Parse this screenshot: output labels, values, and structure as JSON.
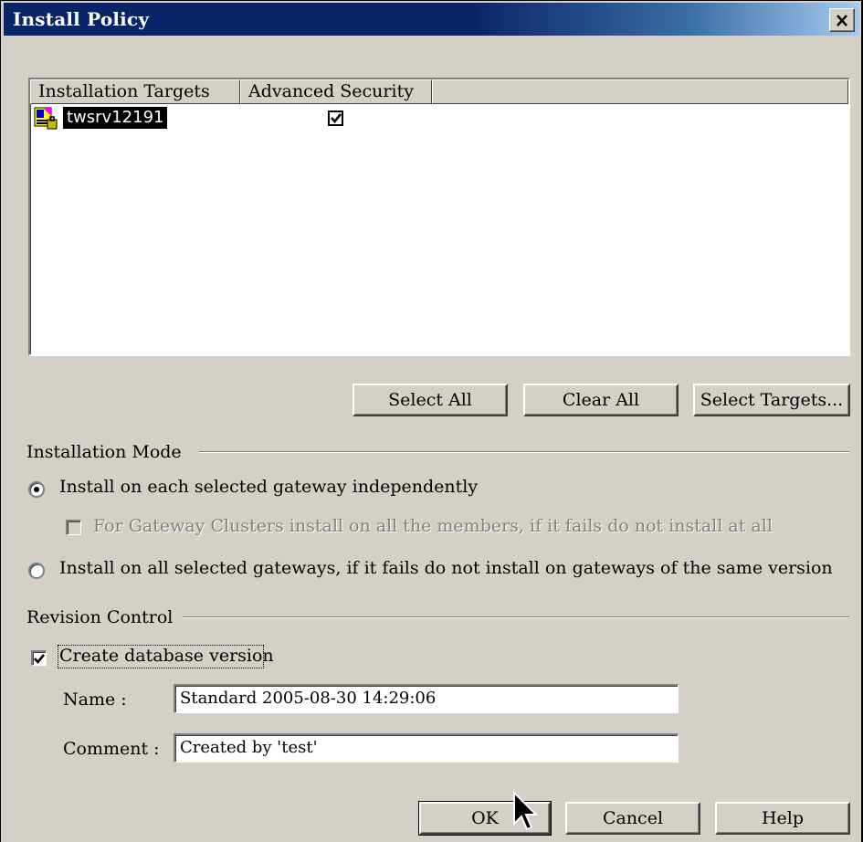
{
  "window": {
    "title": "Install Policy"
  },
  "targets": {
    "columns": [
      "Installation Targets",
      "Advanced Security"
    ],
    "rows": [
      {
        "name": "twsrv12191",
        "advanced_security": true
      }
    ]
  },
  "target_buttons": {
    "select_all": "Select All",
    "clear_all": "Clear All",
    "select_targets": "Select Targets..."
  },
  "installation_mode": {
    "heading": "Installation Mode",
    "option_independent": "Install on each selected gateway independently",
    "option_cluster": "For Gateway Clusters install on all the members, if it fails do not install at all",
    "option_all": "Install on all selected gateways, if it fails do not install on gateways of the same version",
    "selected": "independent"
  },
  "revision_control": {
    "heading": "Revision Control",
    "create_version_label": "Create database version",
    "create_version_checked": true,
    "name_label": "Name :",
    "name_value": "Standard 2005-08-30 14:29:06",
    "comment_label": "Comment :",
    "comment_value": "Created by 'test'"
  },
  "dialog_buttons": {
    "ok": "OK",
    "cancel": "Cancel",
    "help": "Help"
  },
  "icons": [
    "close-icon",
    "gateway-object-icon",
    "check-icon",
    "mouse-cursor-icon"
  ]
}
